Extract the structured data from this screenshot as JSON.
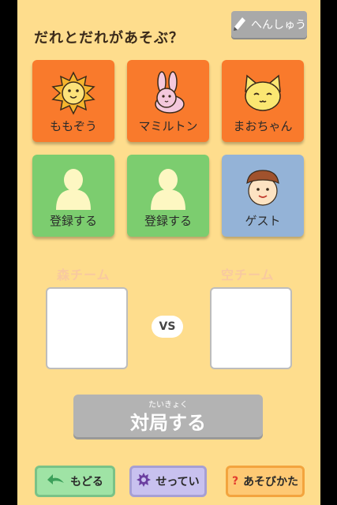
{
  "title": "だれとだれがあそぶ？",
  "edit_button": {
    "label": "へんしゅう",
    "icon": "pencil-icon"
  },
  "players": [
    {
      "label": "ももぞう",
      "icon": "lion-icon",
      "color": "#f97a2c"
    },
    {
      "label": "マミルトン",
      "icon": "rabbit-icon",
      "color": "#f97a2c"
    },
    {
      "label": "まおちゃん",
      "icon": "cat-icon",
      "color": "#f97a2c"
    },
    {
      "label": "登録する",
      "icon": "person-silhouette-icon",
      "color": "#7ccd6f"
    },
    {
      "label": "登録する",
      "icon": "person-silhouette-icon",
      "color": "#7ccd6f"
    },
    {
      "label": "ゲスト",
      "icon": "guest-face-icon",
      "color": "#94b3d7"
    }
  ],
  "teams": {
    "left": "森チーム",
    "right": "空チーム",
    "vs": "VS"
  },
  "start_button": {
    "ruby": "たいきょく",
    "label": "対局する"
  },
  "bottom_nav": {
    "back": {
      "label": "もどる",
      "icon": "back-arrow-icon"
    },
    "settings": {
      "label": "せってい",
      "icon": "gear-icon"
    },
    "howto": {
      "label": "あそびかた",
      "icon": "question-icon"
    }
  }
}
